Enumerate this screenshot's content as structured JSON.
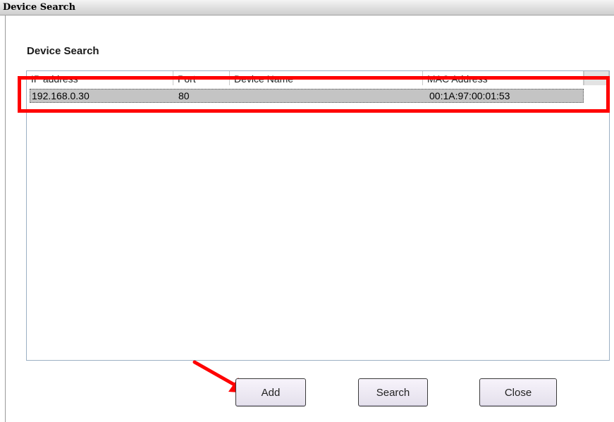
{
  "window": {
    "title": "Device Search"
  },
  "section_label": "Device Search",
  "table": {
    "columns": [
      "IP address",
      "Port",
      "Device Name",
      "MAC Address"
    ],
    "rows": [
      {
        "ip": "192.168.0.30",
        "port": "80",
        "device_name": "",
        "mac": "00:1A:97:00:01:53"
      }
    ]
  },
  "buttons": {
    "add": "Add",
    "search": "Search",
    "close": "Close"
  },
  "colors": {
    "annotation_red": "#ff0000",
    "row_selected": "#c4c4c4"
  }
}
